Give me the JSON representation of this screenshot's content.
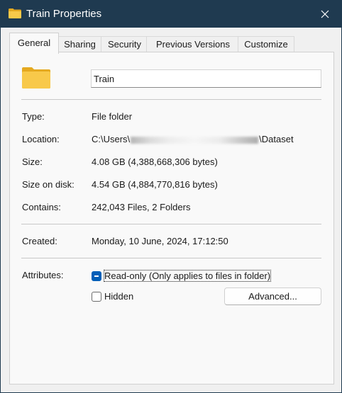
{
  "window": {
    "title": "Train Properties",
    "title_icon": "folder-icon",
    "close_icon": "close-icon"
  },
  "tabs": [
    {
      "label": "General",
      "active": true
    },
    {
      "label": "Sharing",
      "active": false
    },
    {
      "label": "Security",
      "active": false
    },
    {
      "label": "Previous Versions",
      "active": false
    },
    {
      "label": "Customize",
      "active": false
    }
  ],
  "general": {
    "folder_icon": "folder-icon",
    "name": "Train",
    "type_label": "Type:",
    "type_value": "File folder",
    "location_label": "Location:",
    "location_prefix": "C:\\Users\\",
    "location_suffix": "\\Dataset",
    "size_label": "Size:",
    "size_value": "4.08 GB (4,388,668,306 bytes)",
    "size_on_disk_label": "Size on disk:",
    "size_on_disk_value": "4.54 GB (4,884,770,816 bytes)",
    "contains_label": "Contains:",
    "contains_value": "242,043 Files, 2 Folders",
    "created_label": "Created:",
    "created_value": "Monday, 10 June, 2024, 17:12:50",
    "attributes_label": "Attributes:",
    "readonly_label": "Read-only (Only applies to files in folder)",
    "readonly_state": "indeterminate",
    "hidden_label": "Hidden",
    "hidden_checked": false,
    "advanced_button": "Advanced..."
  },
  "colors": {
    "titlebar": "#1f3a50",
    "accent": "#005fb8",
    "folder": "#f8c94a"
  }
}
